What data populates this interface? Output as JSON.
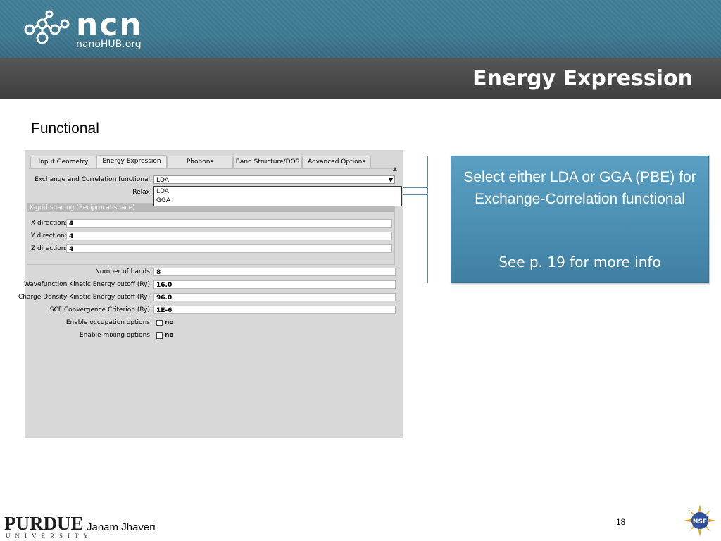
{
  "header": {
    "logo_text": "ncn",
    "logo_subtext": "nanoHUB.org",
    "slide_title": "Energy Expression"
  },
  "section_label": "Functional",
  "app": {
    "tabs": [
      "Input Geometry",
      "Energy Expression",
      "Phonons",
      "Band Structure/DOS",
      "Advanced Options"
    ],
    "active_tab": "Energy Expression",
    "xc_label": "Exchange and Correlation functional:",
    "xc_value": "LDA",
    "relax_label": "Relax:",
    "dropdown_options": [
      "LDA",
      "GGA"
    ],
    "kgrid_header": "K-grid spacing (Reciprocal-space)",
    "kgrid": [
      {
        "label": "X direction:",
        "value": "4"
      },
      {
        "label": "Y direction:",
        "value": "4"
      },
      {
        "label": "Z direction:",
        "value": "4"
      }
    ],
    "params": [
      {
        "label": "Number of bands:",
        "value": "8"
      },
      {
        "label": "Wavefunction Kinetic Energy cutoff (Ry):",
        "value": "16.0"
      },
      {
        "label": "Charge Density Kinetic Energy cutoff (Ry):",
        "value": "96.0"
      },
      {
        "label": "SCF Convergence Criterion (Ry):",
        "value": "1E-6"
      }
    ],
    "checkboxes": [
      {
        "label": "Enable occupation options:",
        "value": "no"
      },
      {
        "label": "Enable mixing options:",
        "value": "no"
      }
    ]
  },
  "callout": {
    "main_text": "Select either LDA or GGA (PBE) for Exchange-Correlation functional",
    "see_text": "See p. 19 for more info",
    "color": "#4a8db0"
  },
  "footer": {
    "university": "PURDUE",
    "university_sub": "UNIVERSITY",
    "author": "Janam Jhaveri",
    "page_number": "18",
    "nsf_logo_text": "NSF"
  }
}
